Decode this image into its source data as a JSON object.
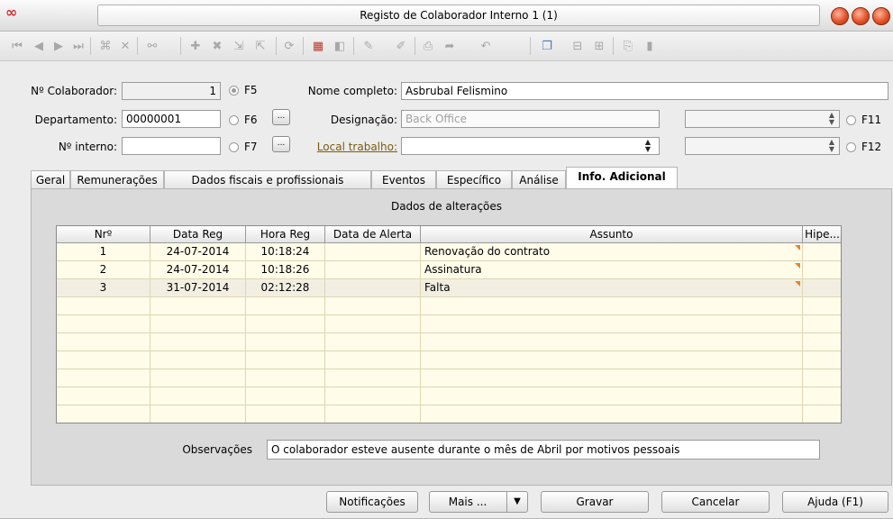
{
  "window": {
    "title": "Registo de Colaborador Interno 1 (1)",
    "logo": "∞"
  },
  "toolbar": {
    "icons": [
      "first-record-icon",
      "prev-record-icon",
      "next-record-icon",
      "last-record-icon",
      "find-icon",
      "delete-filter-icon",
      "binoculars-icon",
      "insert-icon",
      "remove-icon",
      "expand-icon",
      "collapse-icon",
      "clear-icon",
      "calendar-icon",
      "chart-icon",
      "tools-icon",
      "edit-icon",
      "print-icon",
      "export-icon",
      "undo-icon",
      "window-icon",
      "layout-icon",
      "layout-right-icon",
      "attach-icon",
      "bookmark-icon"
    ]
  },
  "form": {
    "colaborador_label": "Nº Colaborador:",
    "colaborador_value": "1",
    "f5": "F5",
    "nome_label": "Nome completo:",
    "nome_value": "Asbrubal Felismino",
    "departamento_label": "Departamento:",
    "departamento_value": "00000001",
    "f6": "F6",
    "designacao_label": "Designação:",
    "designacao_value": "Back Office",
    "f11": "F11",
    "interno_label": "Nº interno:",
    "interno_value": "",
    "f7": "F7",
    "local_label": "Local trabalho:",
    "local_value": "",
    "f12": "F12",
    "dots": "..."
  },
  "tabs": [
    "Geral",
    "Remunerações",
    "Dados fiscais e profissionais",
    "Eventos",
    "Específico",
    "Análise",
    "Info. Adicional"
  ],
  "active_tab": "Info. Adicional",
  "grid": {
    "title": "Dados de alterações",
    "columns": [
      "Nrº",
      "Data Reg",
      "Hora Reg",
      "Data de Alerta",
      "Assunto",
      "Hipe..."
    ],
    "rows": [
      {
        "nr": "1",
        "data": "24-07-2014",
        "hora": "10:18:24",
        "alerta": "",
        "assunto": "Renovação do contrato",
        "hipe": ""
      },
      {
        "nr": "2",
        "data": "24-07-2014",
        "hora": "10:18:26",
        "alerta": "",
        "assunto": "Assinatura",
        "hipe": ""
      },
      {
        "nr": "3",
        "data": "31-07-2014",
        "hora": "02:12:28",
        "alerta": "",
        "assunto": "Falta",
        "hipe": ""
      }
    ]
  },
  "observacoes": {
    "label": "Observações",
    "value": "O colaborador esteve ausente durante o mês de Abril por motivos pessoais"
  },
  "buttons": {
    "notificacoes": "Notificações",
    "mais": "Mais ...",
    "gravar": "Gravar",
    "cancelar": "Cancelar",
    "ajuda": "Ajuda (F1)"
  }
}
